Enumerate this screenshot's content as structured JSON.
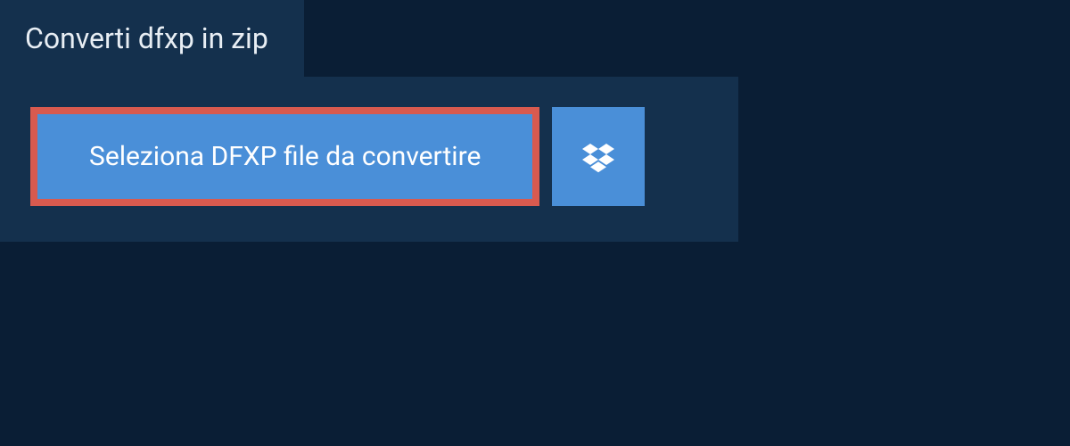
{
  "tab": {
    "title": "Converti dfxp in zip"
  },
  "actions": {
    "select_label": "Seleziona DFXP file da convertire"
  },
  "colors": {
    "bg_outer": "#0a1e35",
    "bg_panel": "#14304d",
    "button_bg": "#4a8fd8",
    "button_border": "#d85a4f",
    "text_light": "#ffffff"
  }
}
